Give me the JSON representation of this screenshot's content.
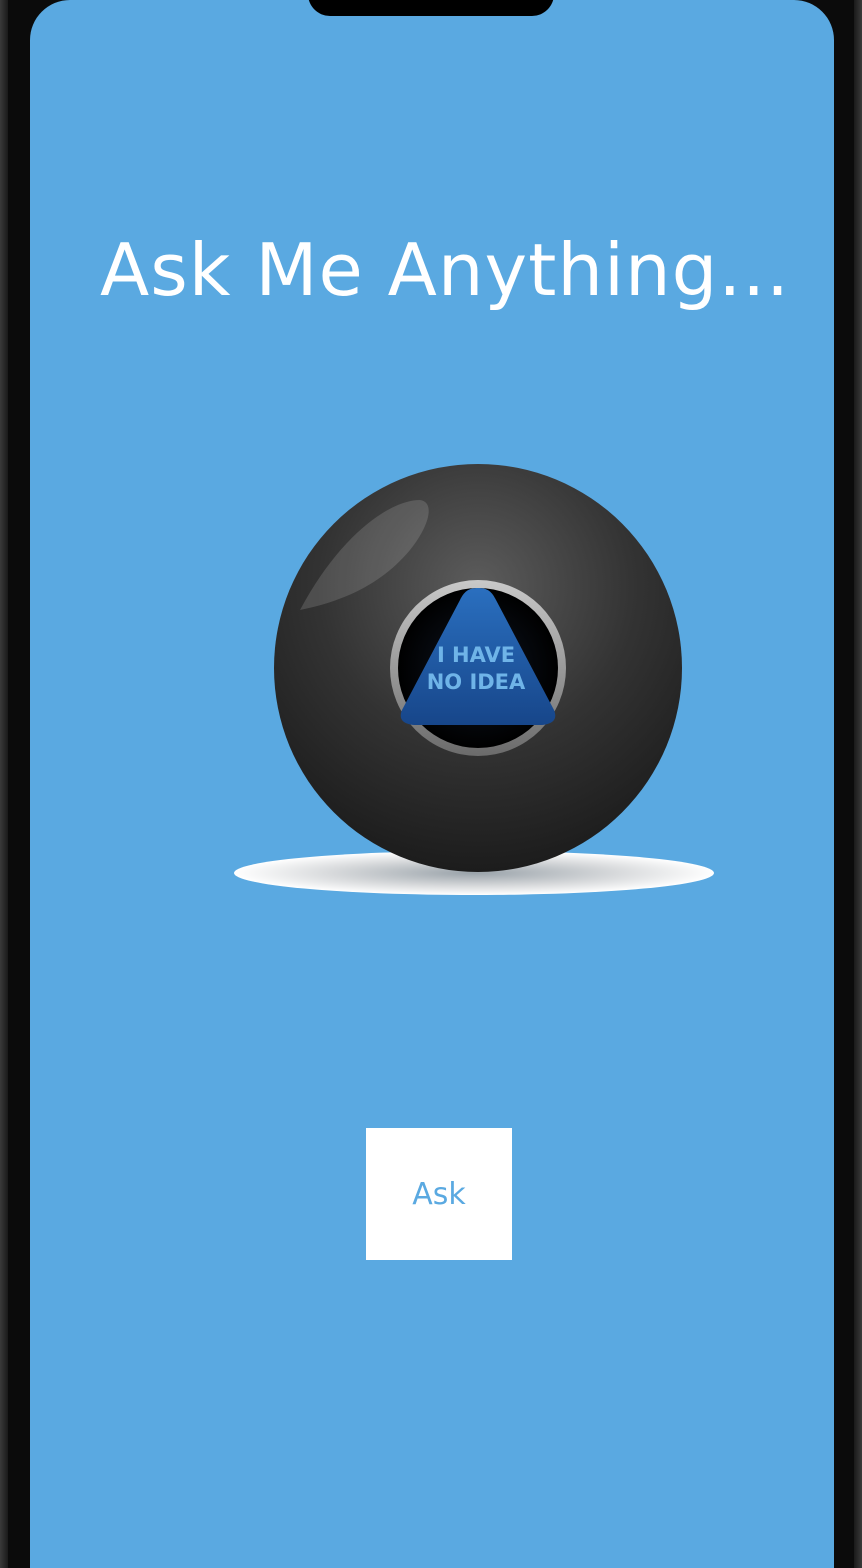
{
  "screen": {
    "title": "Ask Me Anything...",
    "ball": {
      "answer_line1": "I HAVE",
      "answer_line2": "NO IDEA"
    },
    "ask_button_label": "Ask"
  },
  "colors": {
    "background": "#5aa9e1",
    "button_background": "#ffffff",
    "button_text": "#5aa9e1",
    "title_text": "#ffffff",
    "ball_body": "#2b2b2b",
    "answer_triangle": "#1f5a9e",
    "answer_text": "#6fb4e8"
  },
  "icons": {
    "ball": "magic-8-ball-icon"
  }
}
